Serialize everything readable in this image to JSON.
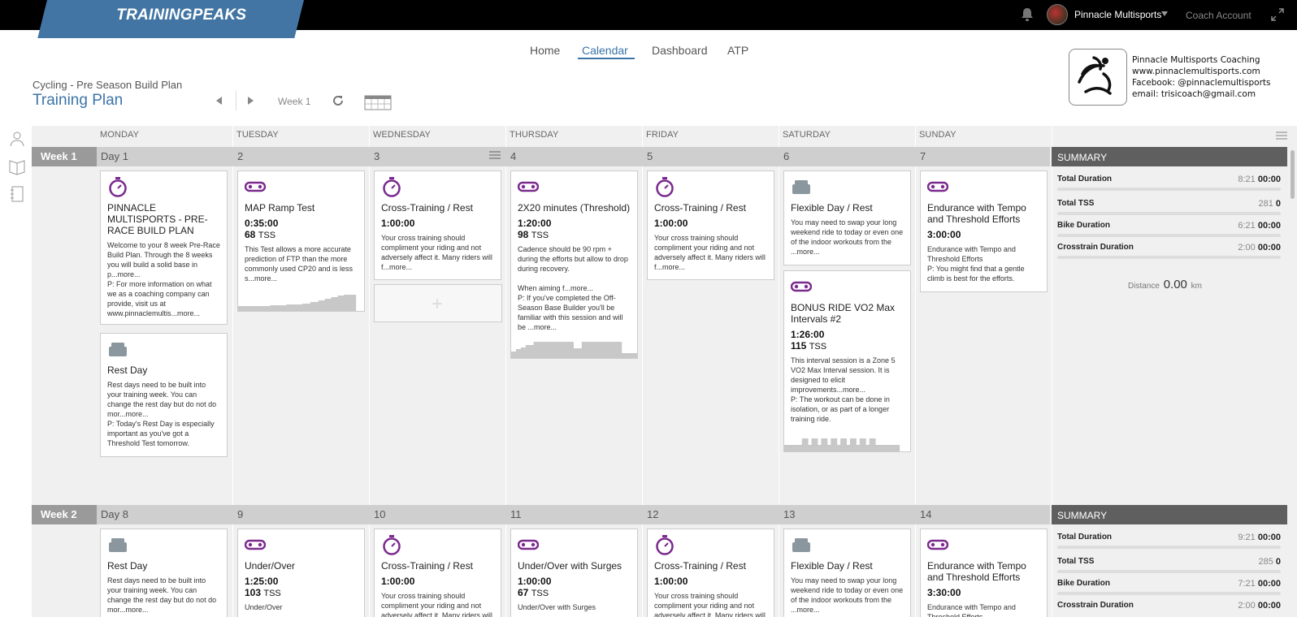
{
  "brand": {
    "name": "TRAININGPEAKS",
    "accent": "#4275a3"
  },
  "topbar": {
    "account_name": "Pinnacle Multisports",
    "coach_account": "Coach Account"
  },
  "nav": [
    {
      "label": "Home"
    },
    {
      "label": "Calendar",
      "active": true
    },
    {
      "label": "Dashboard"
    },
    {
      "label": "ATP"
    }
  ],
  "plan": {
    "subtitle": "Cycling - Pre Season Build Plan",
    "title": "Training Plan",
    "week_label": "Week 1"
  },
  "coach_info": {
    "line1": "Pinnacle Multisports Coaching",
    "line2": "www.pinnaclemultisports.com",
    "line3": "Facebook: @pinnaclemultisports",
    "line4": "email: trisicoach@gmail.com"
  },
  "days": [
    "MONDAY",
    "TUESDAY",
    "WEDNESDAY",
    "THURSDAY",
    "FRIDAY",
    "SATURDAY",
    "SUNDAY"
  ],
  "weeks": [
    {
      "label": "Week 1",
      "day_nums": [
        "Day 1",
        "2",
        "3",
        "4",
        "5",
        "6",
        "7"
      ],
      "summary": {
        "title": "SUMMARY",
        "rows": [
          {
            "label": "Total Duration",
            "planned": "8:21",
            "actual": "00:00"
          },
          {
            "label": "Total TSS",
            "planned": "281",
            "actual": "0"
          },
          {
            "label": "Bike Duration",
            "planned": "6:21",
            "actual": "00:00"
          },
          {
            "label": "Crosstrain Duration",
            "planned": "2:00",
            "actual": "00:00"
          }
        ],
        "distance_label": "Distance",
        "distance_value": "0.00",
        "distance_unit": "km"
      }
    },
    {
      "label": "Week 2",
      "day_nums": [
        "Day 8",
        "9",
        "10",
        "11",
        "12",
        "13",
        "14"
      ],
      "summary": {
        "title": "SUMMARY",
        "rows": [
          {
            "label": "Total Duration",
            "planned": "9:21",
            "actual": "00:00"
          },
          {
            "label": "Total TSS",
            "planned": "285",
            "actual": "0"
          },
          {
            "label": "Bike Duration",
            "planned": "7:21",
            "actual": "00:00"
          },
          {
            "label": "Crosstrain Duration",
            "planned": "2:00",
            "actual": "00:00"
          }
        ]
      }
    }
  ],
  "tss_unit": "TSS",
  "add_symbol": "+",
  "cards": {
    "w1_mon_a": {
      "icon": "stopwatch-icon",
      "title": "PINNACLE MULTISPORTS - PRE-RACE BUILD PLAN",
      "desc": "Welcome to your 8 week Pre-Race Build Plan.  Through the 8 weeks you will build a solid base in p...more...\nP: For more information on what we as a coaching company can provide, visit us at www.pinnaclemultis...more..."
    },
    "w1_mon_b": {
      "icon": "rest-bed-icon",
      "title": "Rest Day",
      "desc": "Rest days need to be built into your training week. You can change the rest day but do not do mor...more...\nP: Today's Rest Day is especially important as you've got a Threshold Test tomorrow."
    },
    "w1_tue": {
      "icon": "bike-chain-icon",
      "title": "MAP Ramp Test",
      "duration": "0:35:00",
      "tss": "68",
      "desc": "This Test allows a more accurate prediction of FTP than the more commonly used CP20 and is less s...more..."
    },
    "w1_wed": {
      "icon": "stopwatch-icon",
      "title": "Cross-Training / Rest",
      "duration": "1:00:00",
      "desc": "Your cross training should compliment your riding and not adversely affect it. Many riders will f...more..."
    },
    "w1_thu": {
      "icon": "bike-chain-icon",
      "title": "2X20 minutes (Threshold)",
      "duration": "1:20:00",
      "tss": "98",
      "desc": "Cadence should be 90 rpm + during the efforts but allow to drop during recovery.\n\nWhen aiming f...more...\nP: If you've completed the Off-Season Base Builder you'll be familiar with this session and will be ...more..."
    },
    "w1_fri": {
      "icon": "stopwatch-icon",
      "title": "Cross-Training / Rest",
      "duration": "1:00:00",
      "desc": "Your cross training should compliment your riding and not adversely affect it. Many riders will f...more..."
    },
    "w1_sat_a": {
      "icon": "rest-bed-icon",
      "title": "Flexible Day / Rest",
      "desc": "You may need to swap your long weekend ride to today or even one of the indoor workouts from the ...more..."
    },
    "w1_sat_b": {
      "icon": "bike-chain-icon",
      "title": "BONUS RIDE VO2 Max Intervals #2",
      "duration": "1:26:00",
      "tss": "115",
      "desc": "This interval session is a Zone 5 VO2 Max Interval session. It is designed to elicit improvements...more...\nP: The workout can be done in isolation, or as part of a longer training ride."
    },
    "w1_sun": {
      "icon": "bike-chain-icon",
      "title": "Endurance with Tempo and Threshold Efforts",
      "duration": "3:00:00",
      "desc": "Endurance with Tempo and Threshold Efforts\nP: You might find that a gentle climb is best for the efforts."
    },
    "w2_mon": {
      "icon": "rest-bed-icon",
      "title": "Rest Day",
      "desc": "Rest days need to be built into your training week. You can change the rest day but do not do mor...more..."
    },
    "w2_tue": {
      "icon": "bike-chain-icon",
      "title": "Under/Over",
      "duration": "1:25:00",
      "tss": "103",
      "desc": "Under/Over"
    },
    "w2_wed": {
      "icon": "stopwatch-icon",
      "title": "Cross-Training / Rest",
      "duration": "1:00:00",
      "desc": "Your cross training should compliment your riding and not adversely affect it. Many riders will f...more..."
    },
    "w2_thu": {
      "icon": "bike-chain-icon",
      "title": "Under/Over with Surges",
      "duration": "1:00:00",
      "tss": "67",
      "desc": "Under/Over with Surges"
    },
    "w2_fri": {
      "icon": "stopwatch-icon",
      "title": "Cross-Training / Rest",
      "duration": "1:00:00",
      "desc": "Your cross training should compliment your riding and not adversely affect it. Many riders will f...more..."
    },
    "w2_sat": {
      "icon": "rest-bed-icon",
      "title": "Flexible Day / Rest",
      "desc": "You may need to swap your long weekend ride to today or even one of the indoor workouts from the ...more..."
    },
    "w2_sun": {
      "icon": "bike-chain-icon",
      "title": "Endurance with Tempo and Threshold Efforts",
      "duration": "3:30:00",
      "desc": "Endurance with Tempo and Threshold Efforts"
    }
  },
  "colors": {
    "workout_icon": "#7b2a8e",
    "rest_icon": "#8a979f",
    "link": "#3b74a8"
  }
}
